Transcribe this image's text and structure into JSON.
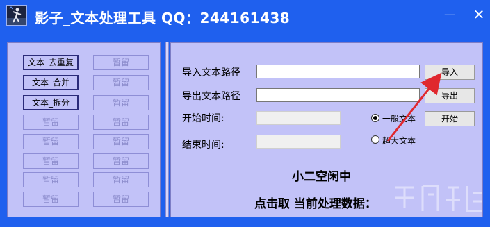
{
  "window": {
    "title": "影子_文本处理工具    QQ：244161438",
    "minimize_glyph": "—",
    "close_glyph": "✕"
  },
  "left_panel": {
    "buttons": [
      {
        "label": "文本_去重复",
        "state": "active"
      },
      {
        "label": "暂留",
        "state": "idle"
      },
      {
        "label": "文本_合并",
        "state": "active"
      },
      {
        "label": "暂留",
        "state": "idle"
      },
      {
        "label": "文本_拆分",
        "state": "active"
      },
      {
        "label": "暂留",
        "state": "idle"
      },
      {
        "label": "暂留",
        "state": "idle"
      },
      {
        "label": "暂留",
        "state": "idle"
      },
      {
        "label": "暂留",
        "state": "idle"
      },
      {
        "label": "暂留",
        "state": "idle"
      },
      {
        "label": "暂留",
        "state": "idle"
      },
      {
        "label": "暂留",
        "state": "idle"
      },
      {
        "label": "暂留",
        "state": "idle"
      },
      {
        "label": "暂留",
        "state": "idle"
      },
      {
        "label": "暂留",
        "state": "idle"
      },
      {
        "label": "暂留",
        "state": "idle"
      }
    ]
  },
  "right_panel": {
    "import_label": "导入文本路径",
    "import_value": "",
    "import_button": "导入",
    "export_label": "导出文本路径",
    "export_value": "",
    "export_button": "导出",
    "start_time_label": "开始时间:",
    "start_time_value": "",
    "end_time_label": "结束时间:",
    "end_time_value": "",
    "radio_normal": "一般文本",
    "radio_large": "超大文本",
    "selected_mode": "一般文本",
    "start_button": "开始",
    "status_text": "小二空闲中",
    "data_text": "点击取 当前处理数据："
  },
  "colors": {
    "title_bar": "#1f60ee",
    "panel": "#c2c2f8",
    "annotation_arrow": "#e0282e"
  },
  "icons": {
    "app_icon": "silhouette-icon"
  }
}
